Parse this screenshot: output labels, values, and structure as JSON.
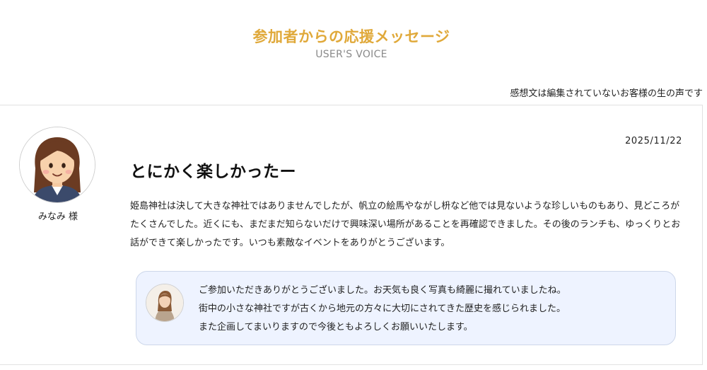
{
  "section": {
    "title": "参加者からの応援メッセージ",
    "subtitle": "USER'S VOICE",
    "disclaimer": "感想文は編集されていないお客様の生の声です"
  },
  "review": {
    "customer_name": "みなみ 様",
    "date": "2025/11/22",
    "title": "とにかく楽しかったー",
    "body": "姫島神社は決して大きな神社ではありませんでしたが、帆立の絵馬やながし枡など他では見ないような珍しいものもあり、見どころがたくさんでした。近くにも、まだまだ知らないだけで興味深い場所があることを再確認できました。その後のランチも、ゆっくりとお話ができて楽しかったです。いつも素敵なイベントをありがとうございます。"
  },
  "reply": {
    "lines": [
      "ご参加いただきありがとうございました。お天気も良く写真も綺麗に撮れていましたね。",
      "街中の小さな神社ですが古くから地元の方々に大切にされてきた歴史を感じられました。",
      "また企画してまいりますので今後ともよろしくお願いいたします。"
    ]
  },
  "colors": {
    "title": "#e0a93a",
    "subtitle": "#8a8a8a",
    "reply_background": "#eef3ff",
    "reply_border": "#cdd7ea",
    "card_border": "#e1e1e1"
  },
  "icons": {
    "customer_avatar": "cartoon-woman-avatar",
    "staff_avatar": "staff-photo-avatar"
  }
}
